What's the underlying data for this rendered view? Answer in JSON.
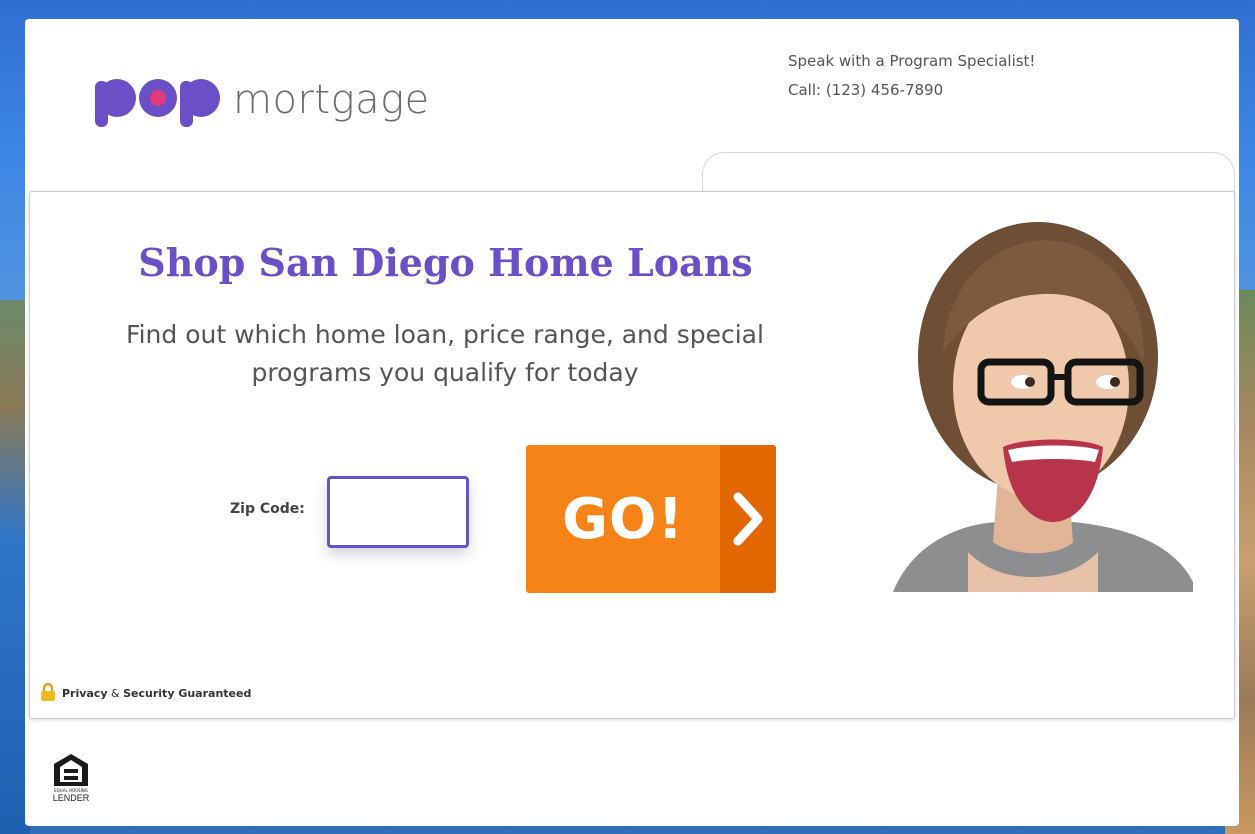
{
  "brand": {
    "logo_word": "mortgage",
    "logo_mark": "pop",
    "colors": {
      "purple": "#6a4fc6",
      "pink": "#e2397a",
      "orange": "#f58318",
      "orange_dark": "#e36700"
    }
  },
  "header": {
    "contact_line1": "Speak with a Program Specialist!",
    "contact_line2": "Call: (123) 456-7890"
  },
  "main": {
    "headline": "Shop San Diego Home Loans",
    "subhead": "Find out which home loan, price range, and special programs you qualify for today",
    "zip_label": "Zip Code:",
    "zip_value": "",
    "go_label": "GO!",
    "go_icon": "chevron-right-icon",
    "photo_alt": "smiling-woman-with-glasses"
  },
  "footer": {
    "privacy_word1": "Privacy",
    "privacy_amp": "&",
    "privacy_word2": "Security Guaranteed",
    "privacy_icon": "lock-icon",
    "ehl_small": "EQUAL HOUSING",
    "ehl_big": "LENDER",
    "ehl_icon": "equal-housing-icon"
  }
}
